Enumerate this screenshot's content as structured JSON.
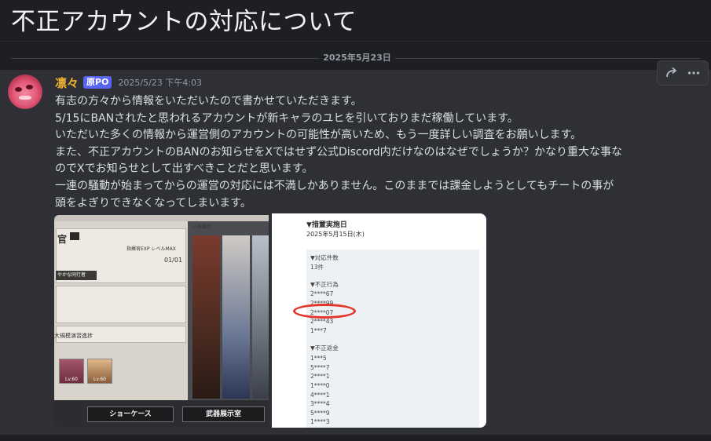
{
  "thread": {
    "title": "不正アカウントの対応について"
  },
  "divider": {
    "date": "2025年5月23日"
  },
  "message": {
    "author": "凛々",
    "badge": "原PO",
    "timestamp": "2025/5/23 下午4:03",
    "lines": [
      "有志の方々から情報をいただいたので書かせていただきます。",
      "5/15にBANされたと思われるアカウントが新キャラのユヒを引いておりまだ稼働しています。",
      "いただいた多くの情報から運営側のアカウントの可能性が高いため、もう一度詳しい調査をお願いします。",
      "また、不正アカウントのBANのお知らせをXではせず公式Discord内だけなのはなぜでしょうか？かなり重大な事な",
      "のでXでお知らせとして出すべきことだと思います。",
      "一連の騒動が始まってからの運営の対応には不満しかありません。このままでは課金しようとしてもチートの事が",
      "頭をよぎりできなくなってしまいます。"
    ]
  },
  "toolbar": {
    "icons": [
      "reply-arrow-icon",
      "more-icon"
    ]
  },
  "attachment_game": {
    "title": "官",
    "exp_label": "指揮官EXP レベルMAX",
    "count": "01/01",
    "tag": "やかな同行者",
    "panel_label": "人形展示",
    "stage_label": "大規模演習進捗",
    "lv1": "Lv.60",
    "lv2": "Lv.60",
    "button1": "ショーケース",
    "button2": "武器展示室"
  },
  "attachment_doc": {
    "heading": "▼措置実施日",
    "date": "2025年5月15日(木)",
    "count_label": "▼対応件数",
    "count_value": "13件",
    "violation_label": "▼不正行為",
    "violations": [
      "2****67",
      "2****99",
      "2****07",
      "2****43",
      "1***7"
    ],
    "refund_label": "▼不正返金",
    "refunds": [
      "1***5",
      "5****7",
      "2****1",
      "1****0",
      "4****1",
      "3****4",
      "5****9",
      "1****3"
    ]
  },
  "colors": {
    "background": "#1e1f22",
    "message_bg": "#2e3035",
    "author": "#f0b232",
    "badge": "#5865f2",
    "highlight_circle": "#e2362b"
  }
}
